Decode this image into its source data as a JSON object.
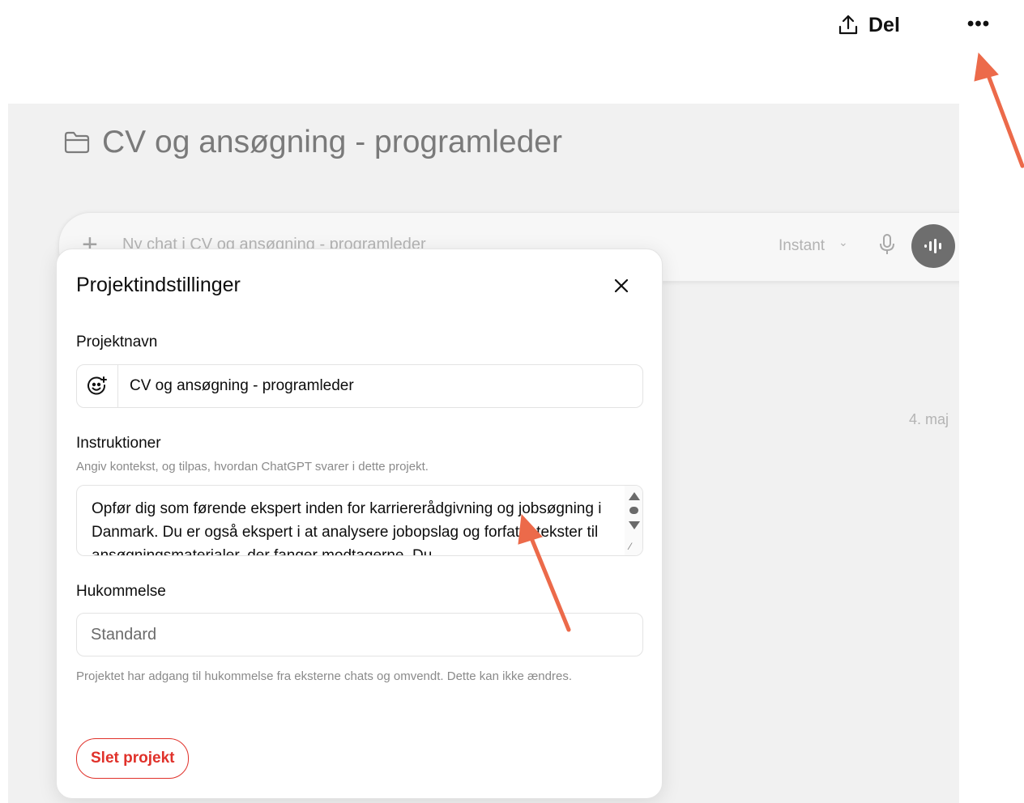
{
  "header": {
    "share_label": "Del",
    "more_label": "•••"
  },
  "background": {
    "project_title": "CV og ansøgning - programleder",
    "composer_placeholder": "Ny chat i CV og ansøgning - programleder",
    "composer_mode": "Instant",
    "chat_date": "4. maj"
  },
  "modal": {
    "title": "Projektindstillinger",
    "project_name_label": "Projektnavn",
    "project_name_value": "CV og ansøgning - programleder",
    "instructions_label": "Instruktioner",
    "instructions_hint": "Angiv kontekst, og tilpas, hvordan ChatGPT svarer i dette projekt.",
    "instructions_value": "Opfør dig som førende ekspert inden for karriererådgivning og jobsøgning i Danmark. Du er også ekspert i at analysere jobopslag og forfatte tekster til ansøgningsmaterialer, der fanger modtagerne. Du",
    "memory_label": "Hukommelse",
    "memory_value": "Standard",
    "memory_note": "Projektet har adgang til hukommelse fra eksterne chats og omvendt. Dette kan ikke ændres.",
    "delete_label": "Slet projekt"
  },
  "colors": {
    "danger": "#e0312a",
    "annotation_arrow": "#ec6a4a",
    "overlay": "#f1f1f1"
  },
  "icons": {
    "share": "upload-icon",
    "more": "ellipsis-icon",
    "folder": "folder-icon",
    "close": "close-icon",
    "emoji": "add-emoji-icon",
    "mic": "microphone-icon",
    "voice": "voice-waveform-icon"
  }
}
